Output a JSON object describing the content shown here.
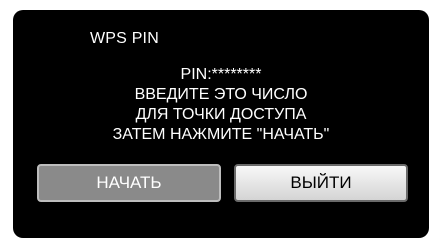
{
  "dialog": {
    "title": "WPS PIN",
    "pin_line": "PIN:********",
    "instruction_lines": [
      "ВВЕДИТЕ ЭТО ЧИСЛО",
      "ДЛЯ ТОЧКИ ДОСТУПА",
      "ЗАТЕМ НАЖМИТЕ \"НАЧАТЬ\""
    ]
  },
  "buttons": {
    "start_label": "НАЧАТЬ",
    "exit_label": "ВЫЙТИ"
  },
  "colors": {
    "screen_background": "#000000",
    "text": "#ffffff",
    "start_button": "#8a8a8a",
    "exit_button": "#e6e6e6"
  }
}
